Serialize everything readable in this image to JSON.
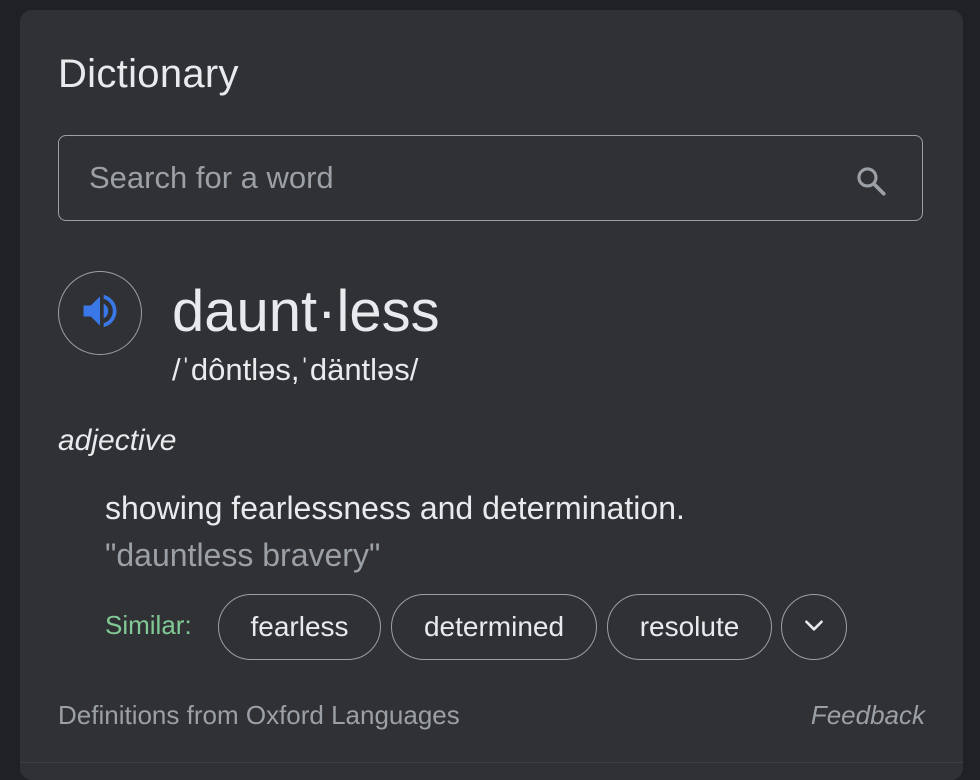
{
  "card": {
    "title": "Dictionary"
  },
  "search": {
    "placeholder": "Search for a word",
    "value": "",
    "icon": "search-icon"
  },
  "entry": {
    "audio_icon": "speaker-icon",
    "audio_color": "#3b78e7",
    "word": "daunt·less",
    "phonetic": "/ˈdôntləs,ˈdäntləs/",
    "part_of_speech": "adjective",
    "definition": "showing fearlessness and determination.",
    "example": "\"dauntless bravery\"",
    "similar_label": "Similar:",
    "similar": [
      "fearless",
      "determined",
      "resolute"
    ],
    "expand_icon": "chevron-down-icon"
  },
  "footer": {
    "source": "Definitions from Oxford Languages",
    "feedback": "Feedback"
  },
  "colors": {
    "background": "#202124",
    "card": "#303134",
    "text": "#e8eaed",
    "secondary_text": "#9aa0a6",
    "similar_label": "#81c995"
  }
}
